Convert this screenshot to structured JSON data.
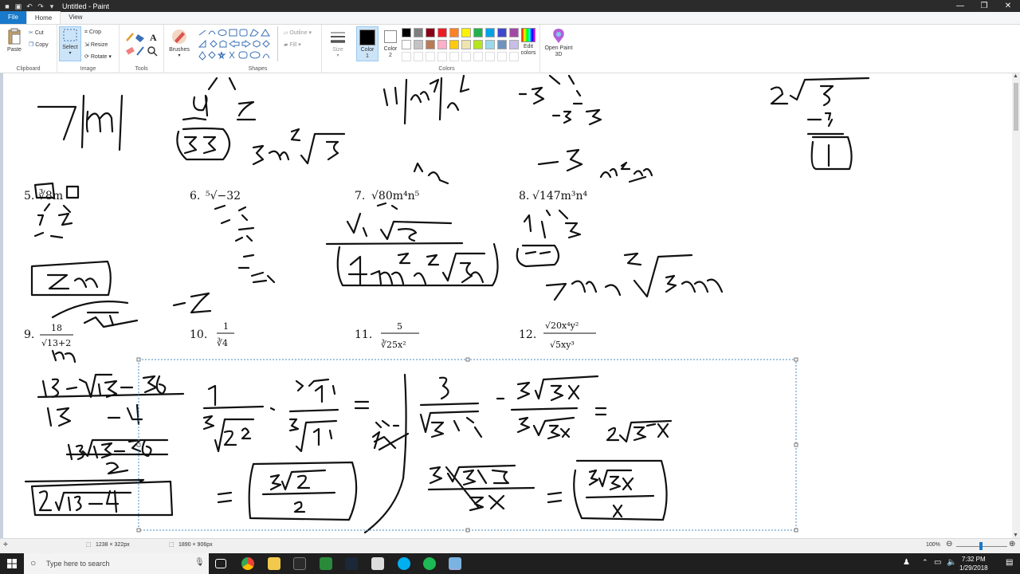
{
  "window": {
    "title": "Untitled - Paint"
  },
  "tabs": [
    "File",
    "Home",
    "View"
  ],
  "ribbon": {
    "clipboard": {
      "paste": "Paste",
      "cut": "Cut",
      "copy": "Copy",
      "label": "Clipboard"
    },
    "image": {
      "select": "Select",
      "crop": "Crop",
      "resize": "Resize",
      "rotate": "Rotate",
      "label": "Image"
    },
    "tools": {
      "label": "Tools"
    },
    "brushes": {
      "label": "Brushes"
    },
    "shapes": {
      "outline": "Outline",
      "fill": "Fill",
      "label": "Shapes"
    },
    "size": {
      "label": "Size"
    },
    "colors": {
      "color1": "Color 1",
      "color2": "Color 2",
      "edit": "Edit colors",
      "label": "Colors"
    },
    "paint3d": {
      "label": "Open Paint 3D"
    },
    "palette_row1": [
      "#000000",
      "#7f7f7f",
      "#880015",
      "#ed1c24",
      "#ff7f27",
      "#fff200",
      "#22b14c",
      "#00a2e8",
      "#3f48cc",
      "#a349a4"
    ],
    "palette_row2": [
      "#ffffff",
      "#c3c3c3",
      "#b97a57",
      "#ffaec9",
      "#ffc90e",
      "#efe4b0",
      "#b5e61d",
      "#99d9ea",
      "#7092be",
      "#c8bfe7"
    ]
  },
  "problems": {
    "p5": {
      "num": "5.",
      "expr": "∛8m"
    },
    "p6": {
      "num": "6.",
      "expr": "⁵√−32"
    },
    "p7": {
      "num": "7.",
      "expr": "√80m⁴n⁵"
    },
    "p8": {
      "num": "8.",
      "expr": "√147m³n⁴"
    },
    "p9": {
      "num": "9.",
      "numer": "18",
      "denom": "√13+2"
    },
    "p10": {
      "num": "10.",
      "numer": "1",
      "denom": "∛4"
    },
    "p11": {
      "num": "11.",
      "numer": "5",
      "denom": "∛25x²"
    },
    "p12": {
      "num": "12.",
      "numer": "√20x⁴y²",
      "denom": "√5xy³"
    }
  },
  "status": {
    "selection": "1238 × 322px",
    "size": "1890 × 906px",
    "zoom": "100%"
  },
  "taskbar": {
    "search": "Type here to search",
    "time": "7:32 PM",
    "date": "1/29/2018"
  }
}
